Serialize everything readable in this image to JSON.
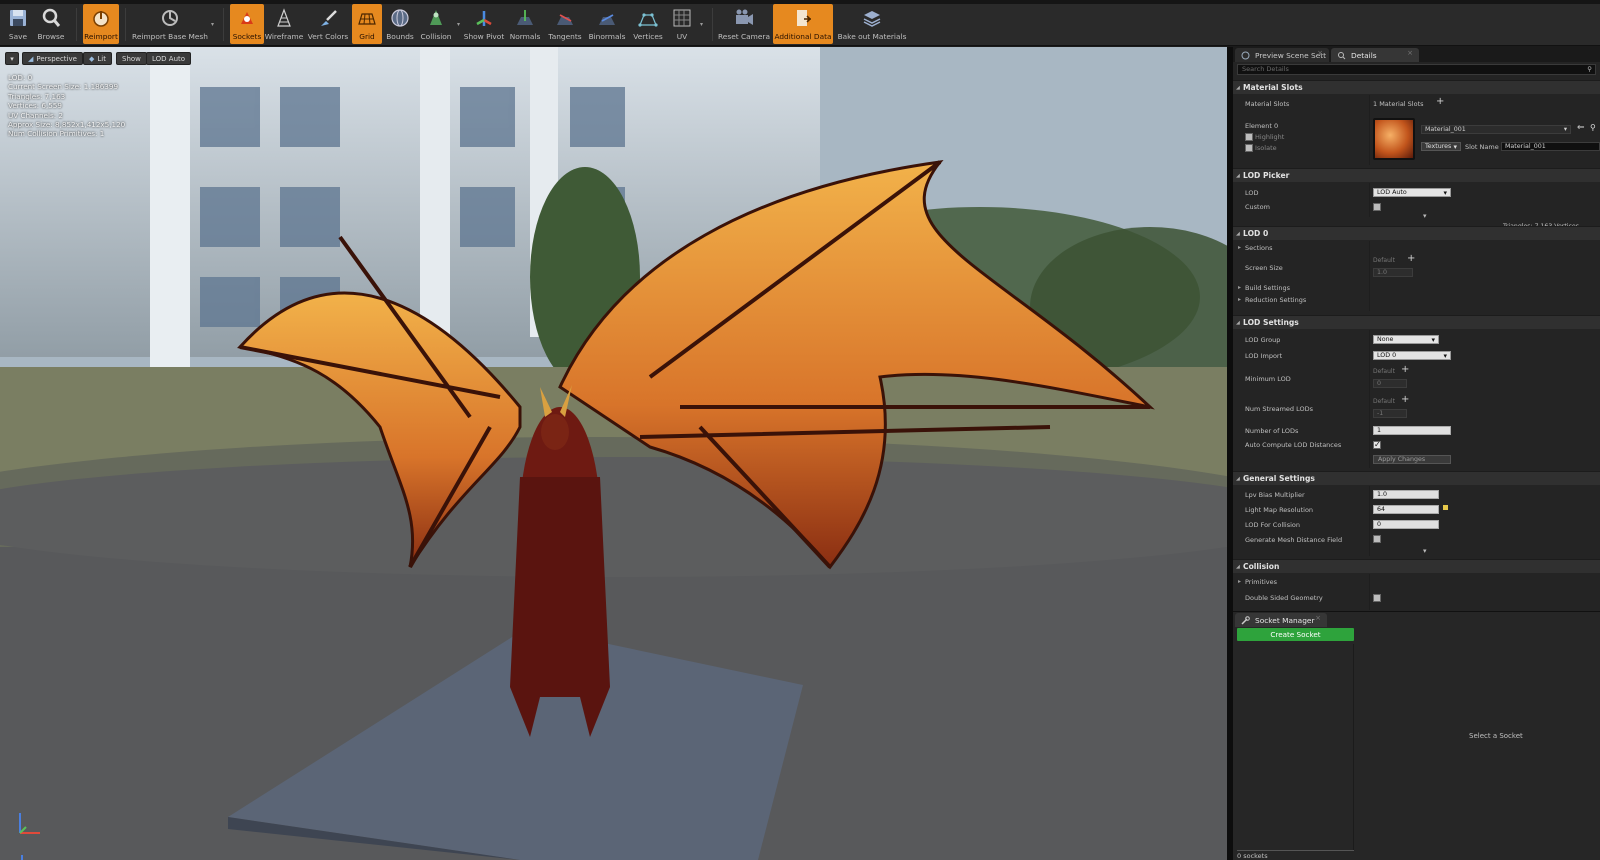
{
  "toolbar": {
    "items": [
      {
        "id": "save",
        "label": "Save",
        "active": false
      },
      {
        "id": "browse",
        "label": "Browse",
        "active": false
      },
      {
        "id": "reimport",
        "label": "Reimport",
        "active": true
      },
      {
        "id": "reimport-base",
        "label": "Reimport Base Mesh",
        "active": false
      },
      {
        "id": "sockets",
        "label": "Sockets",
        "active": true
      },
      {
        "id": "wireframe",
        "label": "Wireframe",
        "active": false
      },
      {
        "id": "vert-colors",
        "label": "Vert Colors",
        "active": false
      },
      {
        "id": "grid",
        "label": "Grid",
        "active": true
      },
      {
        "id": "bounds",
        "label": "Bounds",
        "active": false
      },
      {
        "id": "collision",
        "label": "Collision",
        "active": false
      },
      {
        "id": "show-pivot",
        "label": "Show Pivot",
        "active": false
      },
      {
        "id": "normals",
        "label": "Normals",
        "active": false
      },
      {
        "id": "tangents",
        "label": "Tangents",
        "active": false
      },
      {
        "id": "binormals",
        "label": "Binormals",
        "active": false
      },
      {
        "id": "vertices",
        "label": "Vertices",
        "active": false
      },
      {
        "id": "uv",
        "label": "UV",
        "active": false
      },
      {
        "id": "reset-camera",
        "label": "Reset Camera",
        "active": false
      },
      {
        "id": "additional-data",
        "label": "Additional Data",
        "active": true
      },
      {
        "id": "bake-out",
        "label": "Bake out Materials",
        "active": false
      }
    ]
  },
  "viewport": {
    "perspective_label": "Perspective",
    "lit_label": "Lit",
    "show_label": "Show",
    "lod_auto_label": "LOD Auto",
    "stats": [
      "LOD:  0",
      "Current Screen Size:  1.186399",
      "Triangles:  7,163",
      "Vertices:  6,559",
      "UV Channels:  2",
      "Approx Size: 8,852x1,412x5,120",
      "Num Collision Primitives:  1"
    ]
  },
  "details": {
    "tabs": {
      "preview": "Preview Scene Sett",
      "details": "Details"
    },
    "search_placeholder": "Search Details",
    "material_slots": {
      "header": "Material Slots",
      "label": "Material Slots",
      "count": "1 Material Slots",
      "element": "Element 0",
      "highlight": "Highlight",
      "isolate": "Isolate",
      "material_name": "Material_001",
      "textures": "Textures",
      "slot_name_label": "Slot Name",
      "slot_name_value": "Material_001"
    },
    "lod_picker": {
      "header": "LOD Picker",
      "lod_label": "LOD",
      "lod_value": "LOD Auto",
      "custom_label": "Custom",
      "tris_info": "Triangles: 7,163   Vertices"
    },
    "lod0": {
      "header": "LOD 0",
      "sections": "Sections",
      "screen_size_label": "Screen Size",
      "default": "Default",
      "screen_size_value": "1.0",
      "build_settings": "Build Settings",
      "reduction_settings": "Reduction Settings"
    },
    "lod_settings": {
      "header": "LOD Settings",
      "lod_group_label": "LOD Group",
      "lod_group_value": "None",
      "lod_import_label": "LOD Import",
      "lod_import_value": "LOD 0",
      "min_lod_label": "Minimum LOD",
      "min_lod_default": "Default",
      "min_lod_value": "0",
      "num_streamed_label": "Num Streamed LODs",
      "num_streamed_default": "Default",
      "num_streamed_value": "-1",
      "number_of_lods_label": "Number of LODs",
      "number_of_lods_value": "1",
      "auto_compute_label": "Auto Compute LOD Distances",
      "apply_changes": "Apply Changes"
    },
    "general": {
      "header": "General Settings",
      "lpv_label": "Lpv Bias Multiplier",
      "lpv_value": "1.0",
      "lightmap_label": "Light Map Resolution",
      "lightmap_value": "64",
      "lod_collision_label": "LOD For Collision",
      "lod_collision_value": "0",
      "gen_distance_label": "Generate Mesh Distance Field"
    },
    "collision": {
      "header": "Collision",
      "primitives": "Primitives",
      "double_sided": "Double Sided Geometry"
    },
    "socket_manager": {
      "title": "Socket Manager",
      "create_button": "Create Socket",
      "select_hint": "Select a Socket",
      "count": "0 sockets"
    }
  },
  "colors": {
    "accent": "#e6891f",
    "create": "#2ea33c",
    "panel": "#242424"
  }
}
